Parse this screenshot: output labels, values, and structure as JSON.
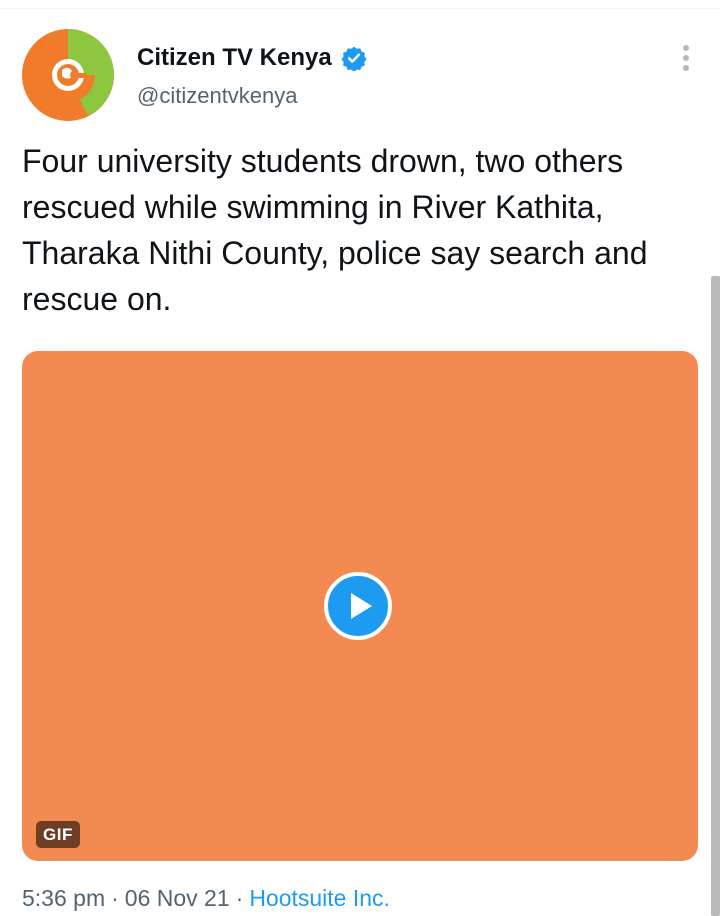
{
  "account": {
    "display_name": "Citizen TV Kenya",
    "handle": "@citizentvkenya",
    "verified": true,
    "avatar_icon": "citizen-tv-logo",
    "brand_colors": {
      "orange": "#f07c2b",
      "green": "#8dc63f"
    }
  },
  "tweet": {
    "text": "Four university students drown, two others rescued while swimming in River Kathita, Tharaka Nithi County, police say search and rescue on."
  },
  "media": {
    "type": "gif",
    "background_color": "#f28a51",
    "badge_label": "GIF",
    "play_icon": "play-icon"
  },
  "meta": {
    "time": "5:36 pm",
    "separator": "·",
    "date": "06 Nov 21",
    "source": "Hootsuite Inc."
  },
  "colors": {
    "text_primary": "#0f1419",
    "text_secondary": "#536471",
    "link": "#1d9bf0",
    "verified_badge": "#1d9bf0"
  }
}
